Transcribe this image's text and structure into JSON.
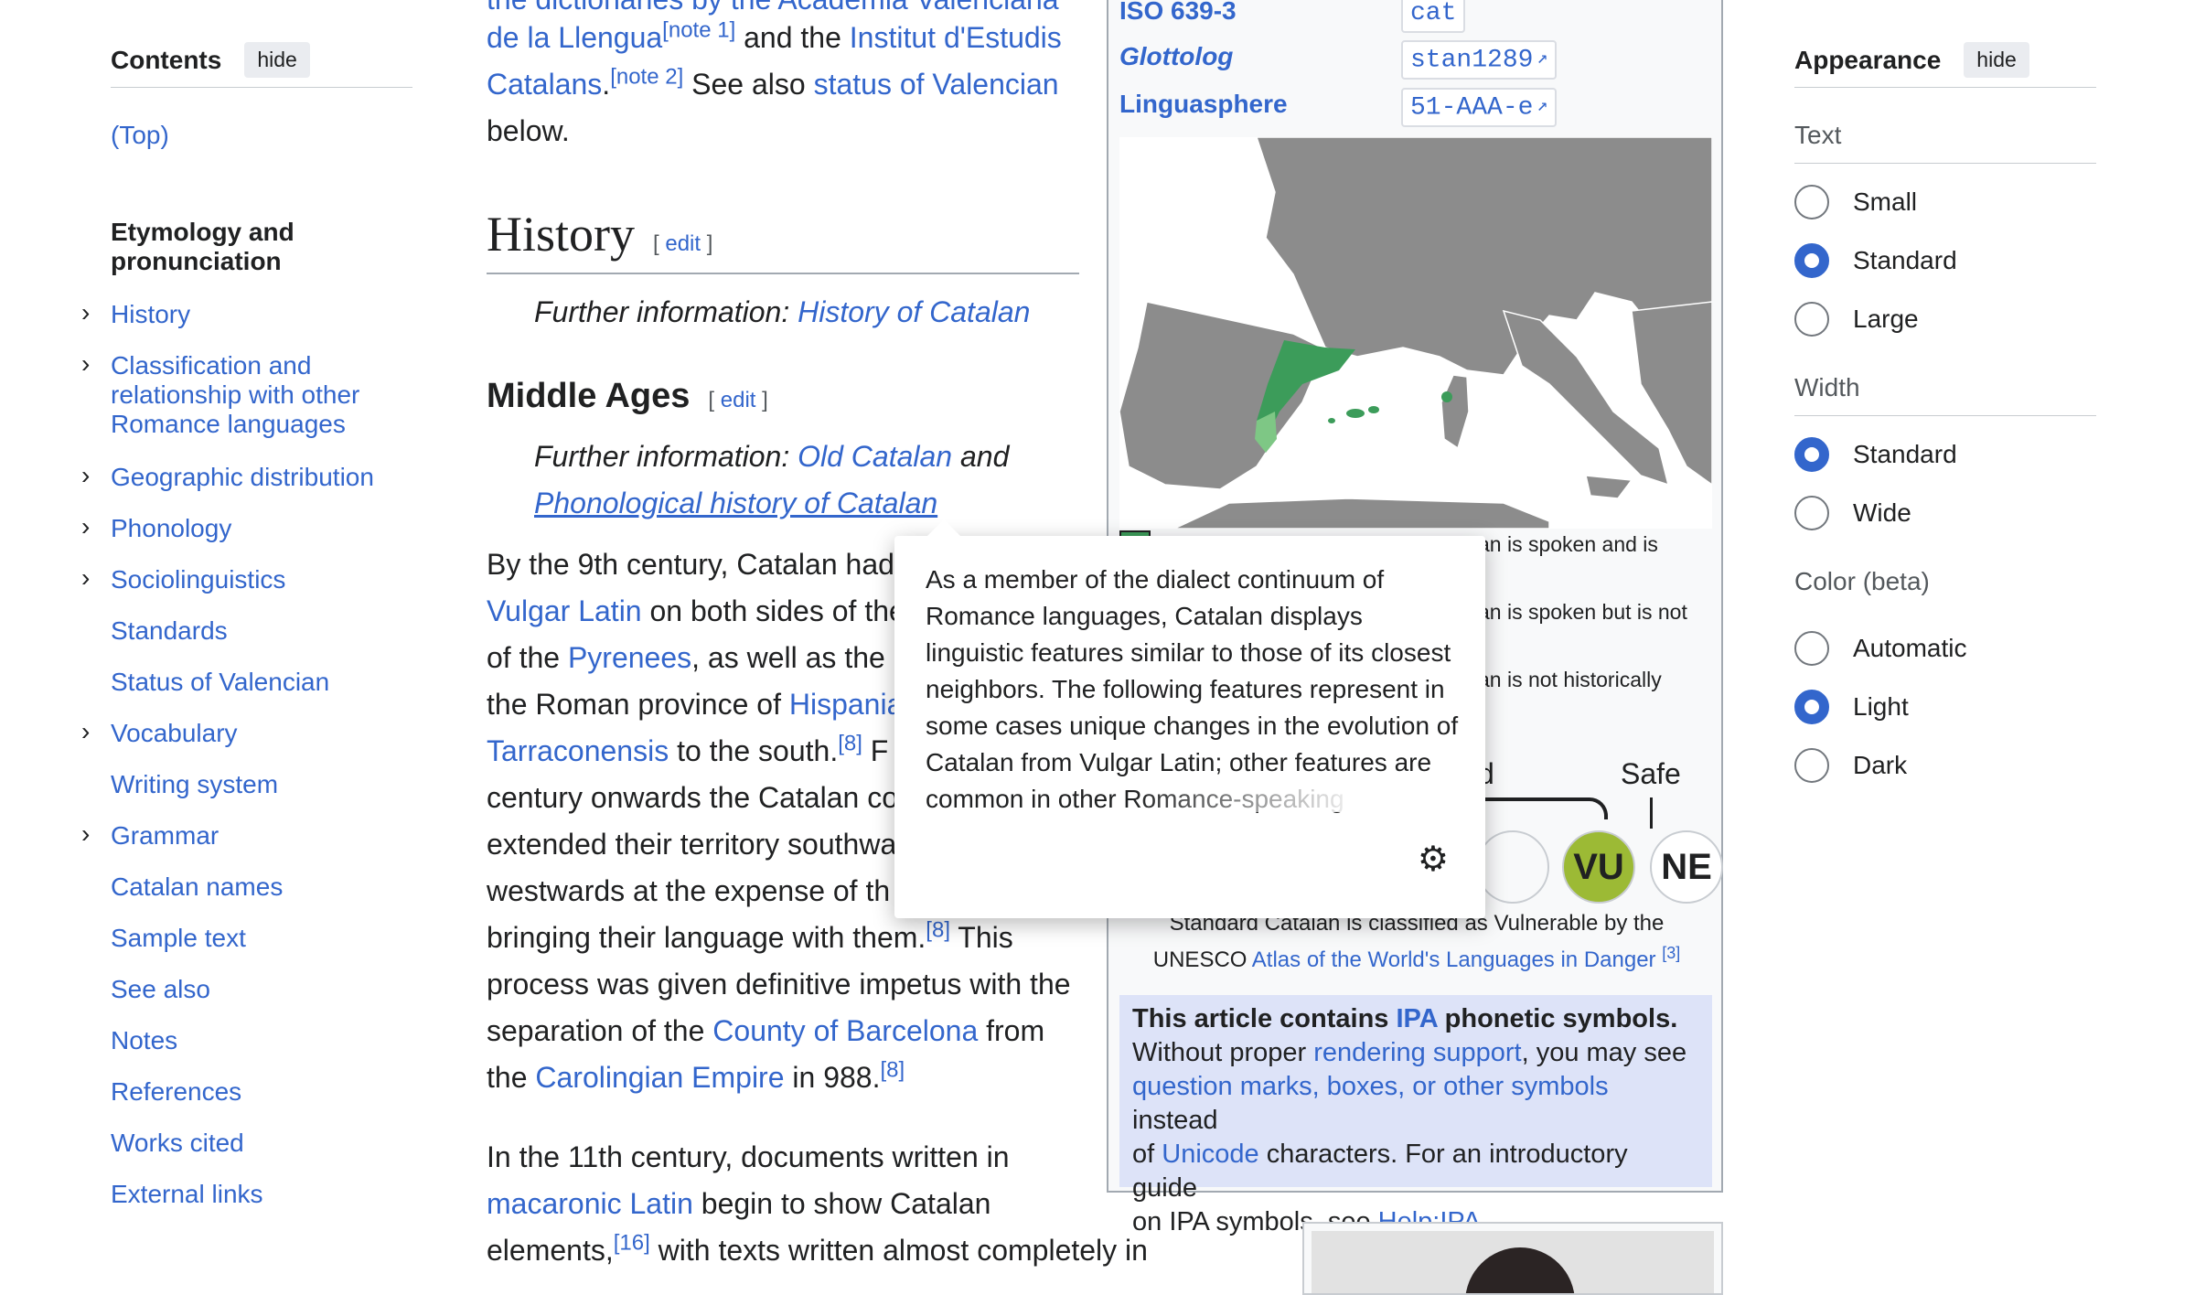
{
  "toc": {
    "title": "Contents",
    "hide_label": "hide",
    "items": [
      {
        "label": "(Top)"
      },
      {
        "label": "Etymology and pronunciation"
      },
      {
        "label": "History"
      },
      {
        "label": "Classification and relationship with other Romance languages"
      },
      {
        "label": "Geographic distribution"
      },
      {
        "label": "Phonology"
      },
      {
        "label": "Sociolinguistics"
      },
      {
        "label": "Standards"
      },
      {
        "label": "Status of Valencian"
      },
      {
        "label": "Vocabulary"
      },
      {
        "label": "Writing system"
      },
      {
        "label": "Grammar"
      },
      {
        "label": "Catalan names"
      },
      {
        "label": "Sample text"
      },
      {
        "label": "See also"
      },
      {
        "label": "Notes"
      },
      {
        "label": "References"
      },
      {
        "label": "Works cited"
      },
      {
        "label": "External links"
      }
    ]
  },
  "article": {
    "intro": {
      "line1_link": "the dictionaries by the Acadèmia Valenciana",
      "line2_link1": "de la Llengua",
      "line2_note1": "[note 1]",
      "line2_text": " and the ",
      "line2_link2": "Institut d'Estudis",
      "line3_link": "Catalans",
      "line3_dot": ".",
      "line3_note2": "[note 2]",
      "line3_text": " See also ",
      "line3_link2": "status of Valencian",
      "line4_text": "below."
    },
    "history_heading": "History",
    "edit_label": "edit",
    "history_hatnote_prefix": "Further information: ",
    "history_hatnote_link": "History of Catalan",
    "middle_ages_heading": "Middle Ages",
    "middle_hatnote_prefix": "Further information: ",
    "middle_hatnote_link1": "Old Catalan",
    "middle_hatnote_and": " and",
    "middle_hatnote_link2": "Phonological history of Catalan",
    "p1": {
      "l1": "By the 9th century, Catalan had",
      "l2_link": "Vulgar Latin",
      "l2_text": " on both sides of the",
      "l3_text1": "of the ",
      "l3_link": "Pyrenees",
      "l3_text2": ", as well as the",
      "l4_text": "the Roman province of ",
      "l4_link": "Hispania",
      "l5_link": "Tarraconensis",
      "l5_text": " to the south.",
      "l5_ref": "[8]",
      "l5_tail": " F",
      "l6": "century onwards the Catalan co",
      "l7": "extended their territory southwa",
      "l8": "westwards at the expense of th",
      "l9_text": "bringing their language with them.",
      "l9_ref": "[8]",
      "l9_tail": " This",
      "l10": "process was given definitive impetus with the",
      "l11_text": "separation of the ",
      "l11_link": "County of Barcelona",
      "l11_tail": " from",
      "l12_text": "the ",
      "l12_link": "Carolingian Empire",
      "l12_tail": " in 988.",
      "l12_ref": "[8]"
    },
    "p2": {
      "l1": "In the 11th century, documents written in",
      "l2_link": "macaronic Latin",
      "l2_text": " begin to show Catalan",
      "l3_text": "elements,",
      "l3_ref": "[16]",
      "l3_tail": " with texts written almost completely in"
    }
  },
  "infobox": {
    "rows": [
      {
        "label": "ISO 639-3",
        "code": "cat"
      },
      {
        "label": "Glottolog",
        "code": "stan1289"
      },
      {
        "label": "Linguasphere",
        "code": "51-AAA-e"
      }
    ],
    "legend": [
      "an is spoken and is",
      "an is spoken but is not",
      "an is not historically"
    ],
    "scale_label_d": "d",
    "scale_label_safe": "Safe",
    "circle_vu": "VU",
    "circle_ne": "NE",
    "unesco_line1": "Standard Catalan is classified as Vulnerable by the",
    "unesco_line2_text": "UNESCO ",
    "unesco_line2_link": "Atlas of the World's Languages in Danger",
    "unesco_ref": "[3]",
    "ipa": {
      "bold1": "This article contains ",
      "bold_link": "IPA",
      "bold2": " phonetic symbols.",
      "t1": "Without proper ",
      "l1": "rendering support",
      "t2": ", you may see",
      "l2": "question marks, boxes, or other symbols",
      "t3": " instead",
      "t4": "of ",
      "l3": "Unicode",
      "t5": " characters. For an introductory guide",
      "t6": "on IPA symbols, see ",
      "l4": "Help:IPA",
      "t7": "."
    }
  },
  "popup": {
    "text": "As a member of the dialect continuum of Romance languages, Catalan displays linguistic features similar to those of its closest neighbors. The following features represent in some cases unique changes in the evolution of Catalan from Vulgar Latin; other features are common in other Romance-speaking",
    "settings_icon": "gear-icon"
  },
  "appearance": {
    "title": "Appearance",
    "hide_label": "hide",
    "text_label": "Text",
    "text_options": [
      "Small",
      "Standard",
      "Large"
    ],
    "text_selected": "Standard",
    "width_label": "Width",
    "width_options": [
      "Standard",
      "Wide"
    ],
    "width_selected": "Standard",
    "color_label": "Color (beta)",
    "color_options": [
      "Automatic",
      "Light",
      "Dark"
    ],
    "color_selected": "Light"
  },
  "colors": {
    "link": "#3366cc",
    "text": "#202122",
    "infobox_bg": "#f8f9fa",
    "ipa_bg": "#dde3f8",
    "map_land": "#8c8c8c",
    "map_catalan": "#3c9c5a",
    "vu_fill": "#9cba35"
  }
}
